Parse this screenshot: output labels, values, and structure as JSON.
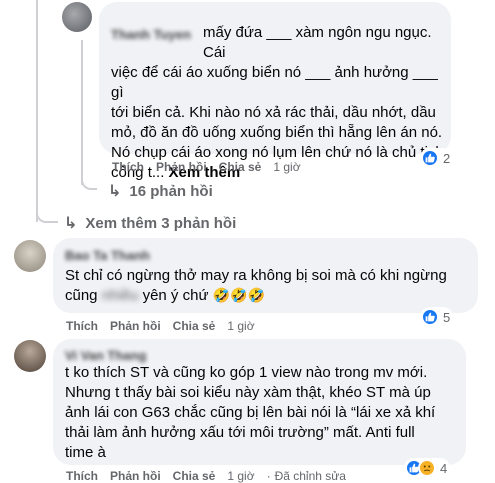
{
  "comments": [
    {
      "author": "Thanh Tuyen",
      "text_lines": [
        "mấy đứa ___ xàm ngôn ngu ngục. Cái",
        "việc để cái áo xuống biển nó ___ ảnh hưởng ___ gì",
        "tới biển cả. Khi nào nó xả rác thải, dầu nhớt, dầu",
        "mỏ, đồ ăn đồ uống xuống biển thì hẵng lên án nó.",
        "Nó chụp cái áo xong nó lụm lên chứ nó là chủ tịch"
      ],
      "text_last": "công t...",
      "see_more": "Xem thêm",
      "actions": [
        "Thích",
        "Phản hồi",
        "Chia sẻ"
      ],
      "time": "1 giờ",
      "reaction_count": "2",
      "replies_label": "16 phản hồi"
    },
    {
      "author": "Bao Ta Thanh",
      "text_lines": [
        "St chỉ có ngừng thở may ra không bị soi mà có khi ngừng"
      ],
      "text_last_pre": "cũng",
      "text_last_post": "yên ý chứ",
      "emojis": "🤣🤣🤣",
      "actions": [
        "Thích",
        "Phản hồi",
        "Chia sẻ"
      ],
      "time": "1 giờ",
      "reaction_count": "5"
    },
    {
      "author": "Vi Van Thang",
      "text_lines": [
        "t ko thích ST và cũng ko góp 1 view nào trong mv mới.",
        "Nhưng t thấy bài soi kiểu này xàm thật, khéo ST mà úp",
        "ảnh lái con G63 chắc cũng bị lên bài nói là “lái xe xả khí",
        "thải làm ảnh hưởng xấu tới môi trường” mất. Anti full",
        "time à"
      ],
      "actions": [
        "Thích",
        "Phản hồi",
        "Chia sẻ"
      ],
      "time": "1 giờ",
      "edited": "Đã chỉnh sửa",
      "reaction_count": "4"
    }
  ],
  "see_more_replies": "Xem thêm 3 phản hồi",
  "colors": {
    "like": "#1877f2",
    "bubble": "#f0f2f5",
    "meta": "#65676b",
    "line": "#ced0d4"
  }
}
